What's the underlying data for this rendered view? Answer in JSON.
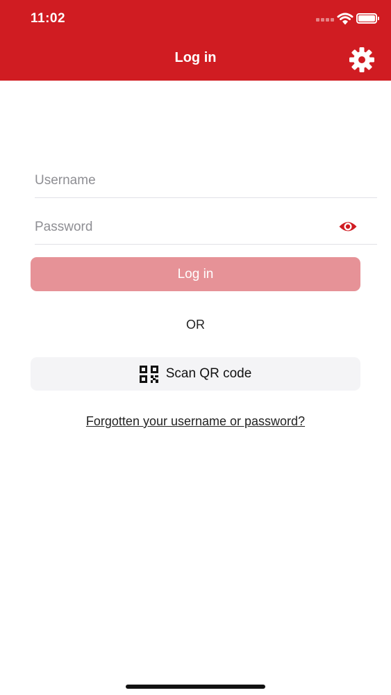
{
  "status_bar": {
    "time": "11:02"
  },
  "header": {
    "title": "Log in"
  },
  "form": {
    "username_placeholder": "Username",
    "password_placeholder": "Password",
    "login_label": "Log in",
    "or_label": "OR",
    "scan_label": "Scan QR code",
    "forgot_label": "Forgotten your username or password?"
  },
  "icons": {
    "settings": "gear-icon",
    "password_toggle": "eye-icon",
    "scan": "qr-code-icon"
  },
  "colors": {
    "brand_red": "#d01c22",
    "login_disabled": "#e69297",
    "scan_background": "#f4f4f6"
  }
}
